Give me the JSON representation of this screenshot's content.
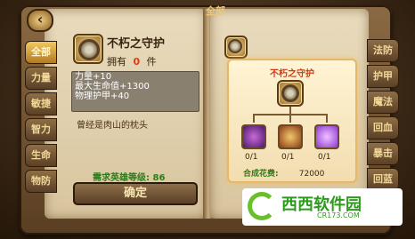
{
  "top_label": "全部",
  "back_icon": "back-arrow-icon",
  "tabs_left": [
    "全部",
    "力量",
    "敏捷",
    "智力",
    "生命",
    "物防"
  ],
  "tabs_right": [
    "法防",
    "护甲",
    "魔法",
    "回血",
    "暴击",
    "回蓝"
  ],
  "item": {
    "name": "不朽之守护",
    "owned_label": "拥有",
    "owned_count": "0",
    "owned_unit": "件",
    "stats": [
      "力量+10",
      "最大生命值+1300",
      "物理护甲+40"
    ],
    "description": "曾经是肉山的枕头",
    "requirement": "需求英雄等级: 86",
    "confirm_label": "确定"
  },
  "recipe": {
    "title": "不朽之守护",
    "materials": [
      {
        "icon": "purple-orb-icon",
        "count": "0/1"
      },
      {
        "icon": "shield-emblem-icon",
        "count": "0/1"
      },
      {
        "icon": "magic-sparkle-icon",
        "count": "0/1"
      }
    ],
    "cost_label": "合成花费:",
    "cost_value": "72000"
  },
  "watermark": {
    "text": "西西软件园",
    "sub": "CR173.COM"
  }
}
